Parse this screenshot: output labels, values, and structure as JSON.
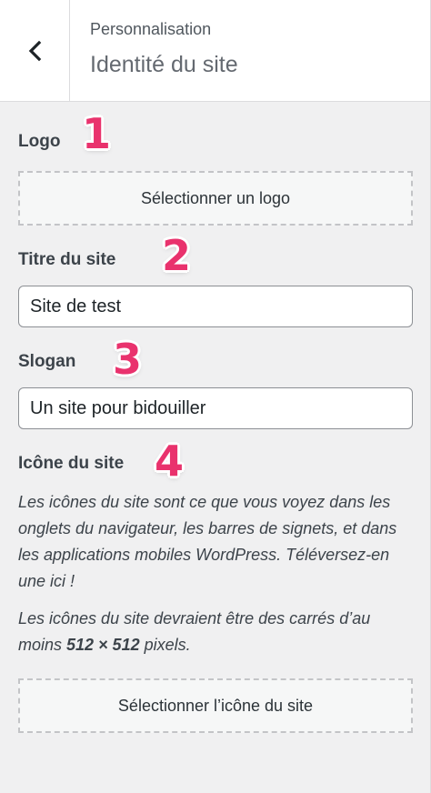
{
  "header": {
    "breadcrumb": "Personnalisation",
    "title": "Identité du site",
    "back_icon": "chevron-left-icon"
  },
  "logo": {
    "label": "Logo",
    "badge": "1",
    "button_label": "Sélectionner un logo"
  },
  "site_title": {
    "label": "Titre du site",
    "badge": "2",
    "value": "Site de test"
  },
  "tagline": {
    "label": "Slogan",
    "badge": "3",
    "value": "Un site pour bidouiller"
  },
  "site_icon": {
    "label": "Icône du site",
    "badge": "4",
    "description_1": "Les icônes du site sont ce que vous voyez dans les onglets du navigateur, les barres de signets, et dans les applications mobiles WordPress. Téléversez-en une ici !",
    "description_2_prefix": "Les icônes du site devraient être des carrés d’au moins ",
    "description_2_size": "512 × 512",
    "description_2_suffix": " pixels.",
    "button_label": "Sélectionner l’icône du site"
  },
  "colors": {
    "badge": "#e9326d",
    "panel_bg": "#f0f0f1",
    "header_bg": "#ffffff"
  }
}
